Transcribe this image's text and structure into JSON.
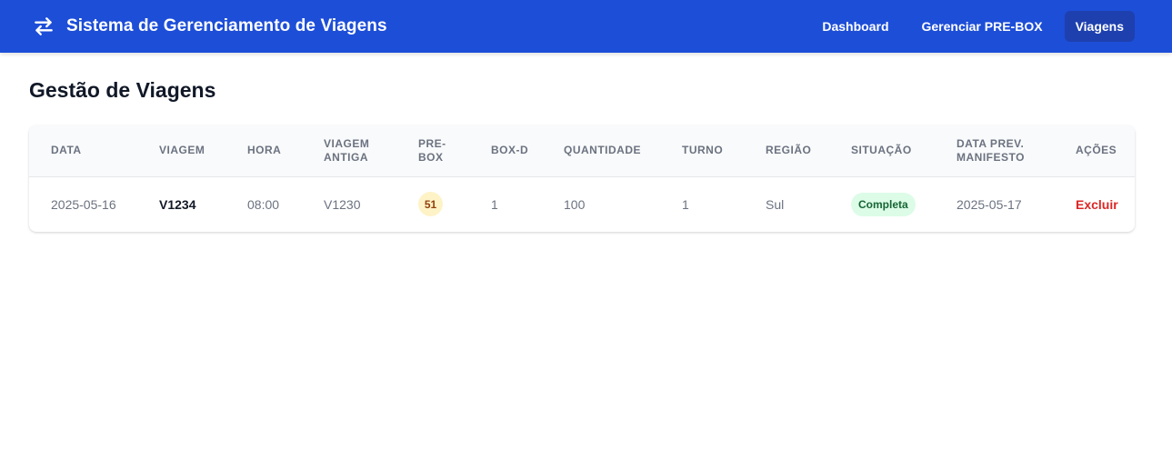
{
  "app": {
    "title": "Sistema de Gerenciamento de Viagens",
    "icon": "swap-arrows-icon"
  },
  "nav": {
    "items": [
      {
        "label": "Dashboard",
        "active": false
      },
      {
        "label": "Gerenciar PRE-BOX",
        "active": false
      },
      {
        "label": "Viagens",
        "active": true
      }
    ]
  },
  "page": {
    "title": "Gestão de Viagens"
  },
  "table": {
    "headers": [
      "Data",
      "Viagem",
      "Hora",
      "Viagem Antiga",
      "Pre-box",
      "Box-D",
      "Quantidade",
      "Turno",
      "Região",
      "Situação",
      "Data Prev. Manifesto",
      "Ações"
    ],
    "rows": [
      {
        "data": "2025-05-16",
        "viagem": "V1234",
        "hora": "08:00",
        "viagem_antiga": "V1230",
        "prebox": "51",
        "boxd": "1",
        "quantidade": "100",
        "turno": "1",
        "regiao": "Sul",
        "situacao": "Completa",
        "data_prev_manifesto": "2025-05-17",
        "acao": "Excluir"
      }
    ]
  },
  "colors": {
    "primary": "#1d4ed8",
    "active_nav": "#1e40af",
    "status_complete_bg": "#dcfce7",
    "status_complete_text": "#166534",
    "prebox_bg": "#fef3c7",
    "danger": "#dc2626"
  }
}
